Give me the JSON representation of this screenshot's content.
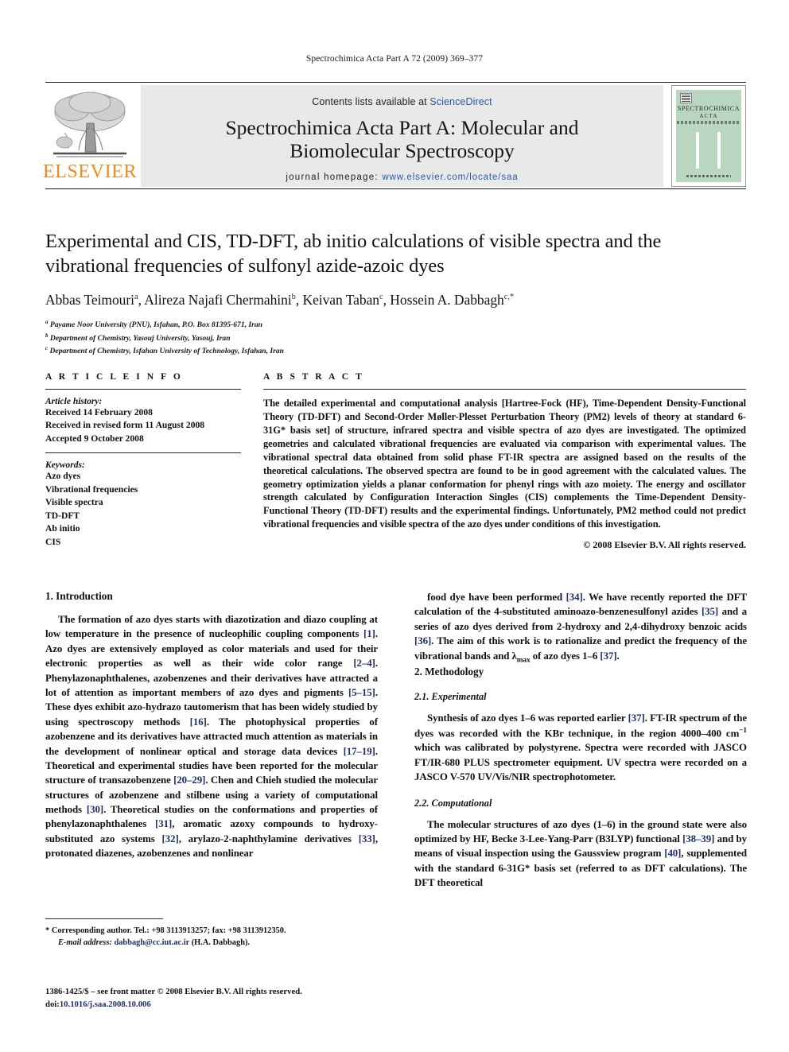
{
  "running_head": "Spectrochimica Acta Part A 72 (2009) 369–377",
  "masthead": {
    "publisher_name": "ELSEVIER",
    "contents_prefix": "Contents lists available at ",
    "contents_link": "ScienceDirect",
    "journal_title_line1": "Spectrochimica Acta Part A: Molecular and",
    "journal_title_line2": "Biomolecular Spectroscopy",
    "homepage_label": "journal homepage:",
    "homepage_url": "www.elsevier.com/locate/saa",
    "cover_title_line1": "SPECTROCHIMICA",
    "cover_title_line2": "ACTA"
  },
  "article": {
    "title": "Experimental and CIS, TD-DFT, ab initio calculations of visible spectra and the vibrational frequencies of sulfonyl azide-azoic dyes",
    "authors_html": "Abbas Teimouri<sup>a</sup>, Alireza Najafi Chermahini<sup>b</sup>, Keivan Taban<sup>c</sup>, Hossein A. Dabbagh<sup>c,*</sup>",
    "affiliations": [
      "Payame Noor University (PNU), Isfahan, P.O. Box 81395-671, Iran",
      "Department of Chemistry, Yasouj University, Yasouj, Iran",
      "Department of Chemistry, Isfahan University of Technology, Isfahan, Iran"
    ],
    "affiliation_markers": [
      "a",
      "b",
      "c"
    ]
  },
  "article_info": {
    "heading": "A R T I C L E  I N F O",
    "history_label": "Article history:",
    "history": [
      "Received 14 February 2008",
      "Received in revised form 11 August 2008",
      "Accepted 9 October 2008"
    ],
    "keywords_label": "Keywords:",
    "keywords": [
      "Azo dyes",
      "Vibrational frequencies",
      "Visible spectra",
      "TD-DFT",
      "Ab initio",
      "CIS"
    ]
  },
  "abstract": {
    "heading": "A B S T R A C T",
    "text": "The detailed experimental and computational analysis [Hartree-Fock (HF), Time-Dependent Density-Functional Theory (TD-DFT) and Second-Order Møller-Plesset Perturbation Theory (PM2) levels of theory at standard 6-31G* basis set] of structure, infrared spectra and visible spectra of azo dyes are investigated. The optimized geometries and calculated vibrational frequencies are evaluated via comparison with experimental values. The vibrational spectral data obtained from solid phase FT-IR spectra are assigned based on the results of the theoretical calculations. The observed spectra are found to be in good agreement with the calculated values. The geometry optimization yields a planar conformation for phenyl rings with azo moiety. The energy and oscillator strength calculated by Configuration Interaction Singles (CIS) complements the Time-Dependent Density-Functional Theory (TD-DFT) results and the experimental findings. Unfortunately, PM2 method could not predict vibrational frequencies and visible spectra of the azo dyes under conditions of this investigation.",
    "copyright": "© 2008 Elsevier B.V. All rights reserved."
  },
  "sections": {
    "introduction_heading": "1.  Introduction",
    "intro_para_left": "The formation of azo dyes starts with diazotization and diazo coupling at low temperature in the presence of nucleophilic coupling components [1]. Azo dyes are extensively employed as color materials and used for their electronic properties as well as their wide color range [2–4]. Phenylazonaphthalenes, azobenzenes and their derivatives have attracted a lot of attention as important members of azo dyes and pigments [5–15]. These dyes exhibit azo-hydrazo tautomerism that has been widely studied by using spectroscopy methods [16]. The photophysical properties of azobenzene and its derivatives have attracted much attention as materials in the development of nonlinear optical and storage data devices [17–19]. Theoretical and experimental studies have been reported for the molecular structure of transazobenzene [20–29]. Chen and Chieh studied the molecular structures of azobenzene and stilbene using a variety of computational methods [30]. Theoretical studies on the conformations and properties of phenylazonaphthalenes [31], aromatic azoxy compounds to hydroxy-substituted azo systems [32], arylazo-2-naphthylamine derivatives [33], protonated diazenes, azobenzenes and nonlinear",
    "intro_para_right": "food dye have been performed [34]. We have recently reported the DFT calculation of the 4-substituted aminoazo-benzenesulfonyl azides [35] and a series of azo dyes derived from 2-hydroxy and 2,4-dihydroxy benzoic acids [36]. The aim of this work is to rationalize and predict the frequency of the vibrational bands and λmax of azo dyes 1–6 [37].",
    "methodology_heading": "2.  Methodology",
    "experimental_heading": "2.1.  Experimental",
    "experimental_para": "Synthesis of azo dyes 1–6 was reported earlier [37]. FT-IR spectrum of the dyes was recorded with the KBr technique, in the region 4000–400 cm−1 which was calibrated by polystyrene. Spectra were recorded with JASCO FT/IR-680 PLUS spectrometer equipment. UV spectra were recorded on a JASCO V-570 UV/Vis/NIR spectrophotometer.",
    "computational_heading": "2.2.  Computational",
    "computational_para": "The molecular structures of azo dyes (1–6) in the ground state were also optimized by HF, Becke 3-Lee-Yang-Parr (B3LYP) functional [38–39] and by means of visual inspection using the Gaussview program [40], supplemented with the standard 6-31G* basis set (referred to as DFT calculations). The DFT theoretical"
  },
  "footnotes": {
    "corresponding_marker": "*",
    "corresponding_text": "Corresponding author. Tel.: +98 3113913257; fax: +98 3113912350.",
    "email_label": "E-mail address:",
    "email": "dabbagh@cc.iut.ac.ir",
    "email_owner": "(H.A. Dabbagh).",
    "issn_line": "1386-1425/$ – see front matter © 2008 Elsevier B.V. All rights reserved.",
    "doi_label": "doi:",
    "doi_value": "10.1016/j.saa.2008.10.006"
  },
  "colors": {
    "link": "#2b58a6",
    "citation": "#1c2f6b",
    "elsevier_orange": "#f08a1c",
    "band_gray": "#e9e9e9",
    "cover_green": "#b9d6c0"
  }
}
